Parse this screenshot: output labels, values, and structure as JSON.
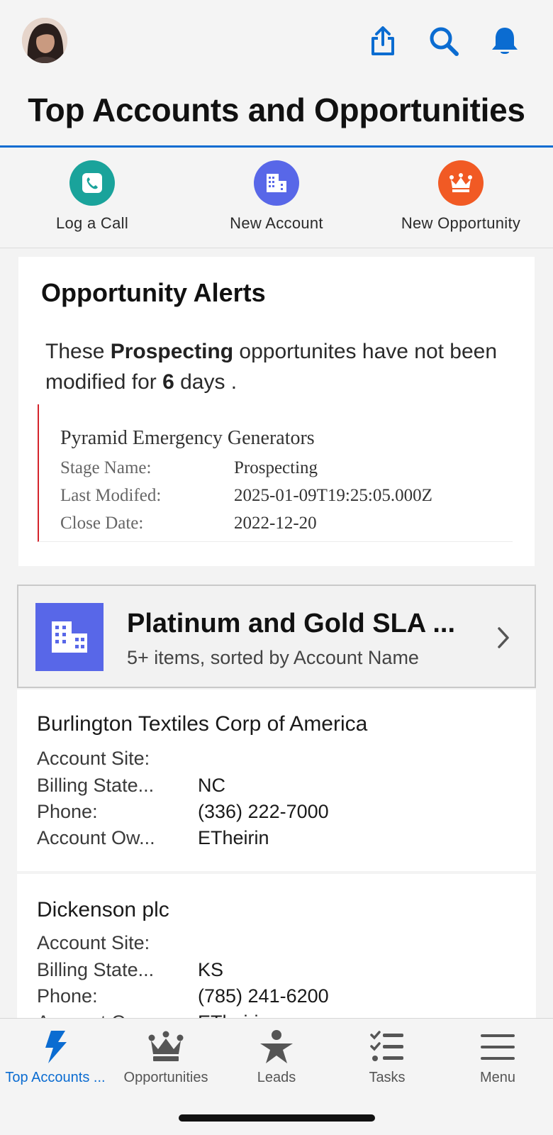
{
  "header": {
    "title": "Top Accounts and Opportunities",
    "icons": [
      "share-icon",
      "search-icon",
      "bell-icon"
    ]
  },
  "quick_actions": [
    {
      "label": "Log a Call",
      "icon": "phone-icon",
      "color": "#1aa39b"
    },
    {
      "label": "New Account",
      "icon": "building-icon",
      "color": "#5867e8"
    },
    {
      "label": "New Opportunity",
      "icon": "crown-icon",
      "color": "#f15a24"
    }
  ],
  "alerts": {
    "title": "Opportunity Alerts",
    "message_pre": "These ",
    "stage": "Prospecting",
    "message_mid": " opportunites have not been modified for ",
    "days": "6",
    "message_post": " days .",
    "opportunity": {
      "name": "Pyramid Emergency Generators",
      "fields": [
        {
          "label": "Stage Name:",
          "value": "Prospecting"
        },
        {
          "label": "Last Modifed:",
          "value": "2025-01-09T19:25:05.000Z"
        },
        {
          "label": "Close Date:",
          "value": "2022-12-20"
        }
      ]
    }
  },
  "list_view": {
    "title": "Platinum and Gold SLA ...",
    "subtitle": "5+ items, sorted by Account Name",
    "icon": "building-icon",
    "icon_color": "#5867e8"
  },
  "records": [
    {
      "name": "Burlington Textiles Corp of America",
      "fields": [
        {
          "label": "Account Site:",
          "value": ""
        },
        {
          "label": "Billing State...",
          "value": "NC"
        },
        {
          "label": "Phone:",
          "value": "(336) 222-7000"
        },
        {
          "label": "Account Ow...",
          "value": "ETheirin"
        }
      ]
    },
    {
      "name": "Dickenson plc",
      "fields": [
        {
          "label": "Account Site:",
          "value": ""
        },
        {
          "label": "Billing State...",
          "value": "KS"
        },
        {
          "label": "Phone:",
          "value": "(785) 241-6200"
        },
        {
          "label": "Account Ow...",
          "value": "ETheirin"
        }
      ]
    }
  ],
  "tabs": [
    {
      "label": "Top Accounts ...",
      "icon": "lightning-icon",
      "active": true
    },
    {
      "label": "Opportunities",
      "icon": "crown-icon",
      "active": false
    },
    {
      "label": "Leads",
      "icon": "person-star-icon",
      "active": false
    },
    {
      "label": "Tasks",
      "icon": "checklist-icon",
      "active": false
    },
    {
      "label": "Menu",
      "icon": "hamburger-icon",
      "active": false
    }
  ],
  "colors": {
    "accent": "#0b6cd1",
    "alert_border": "#d4242c"
  }
}
